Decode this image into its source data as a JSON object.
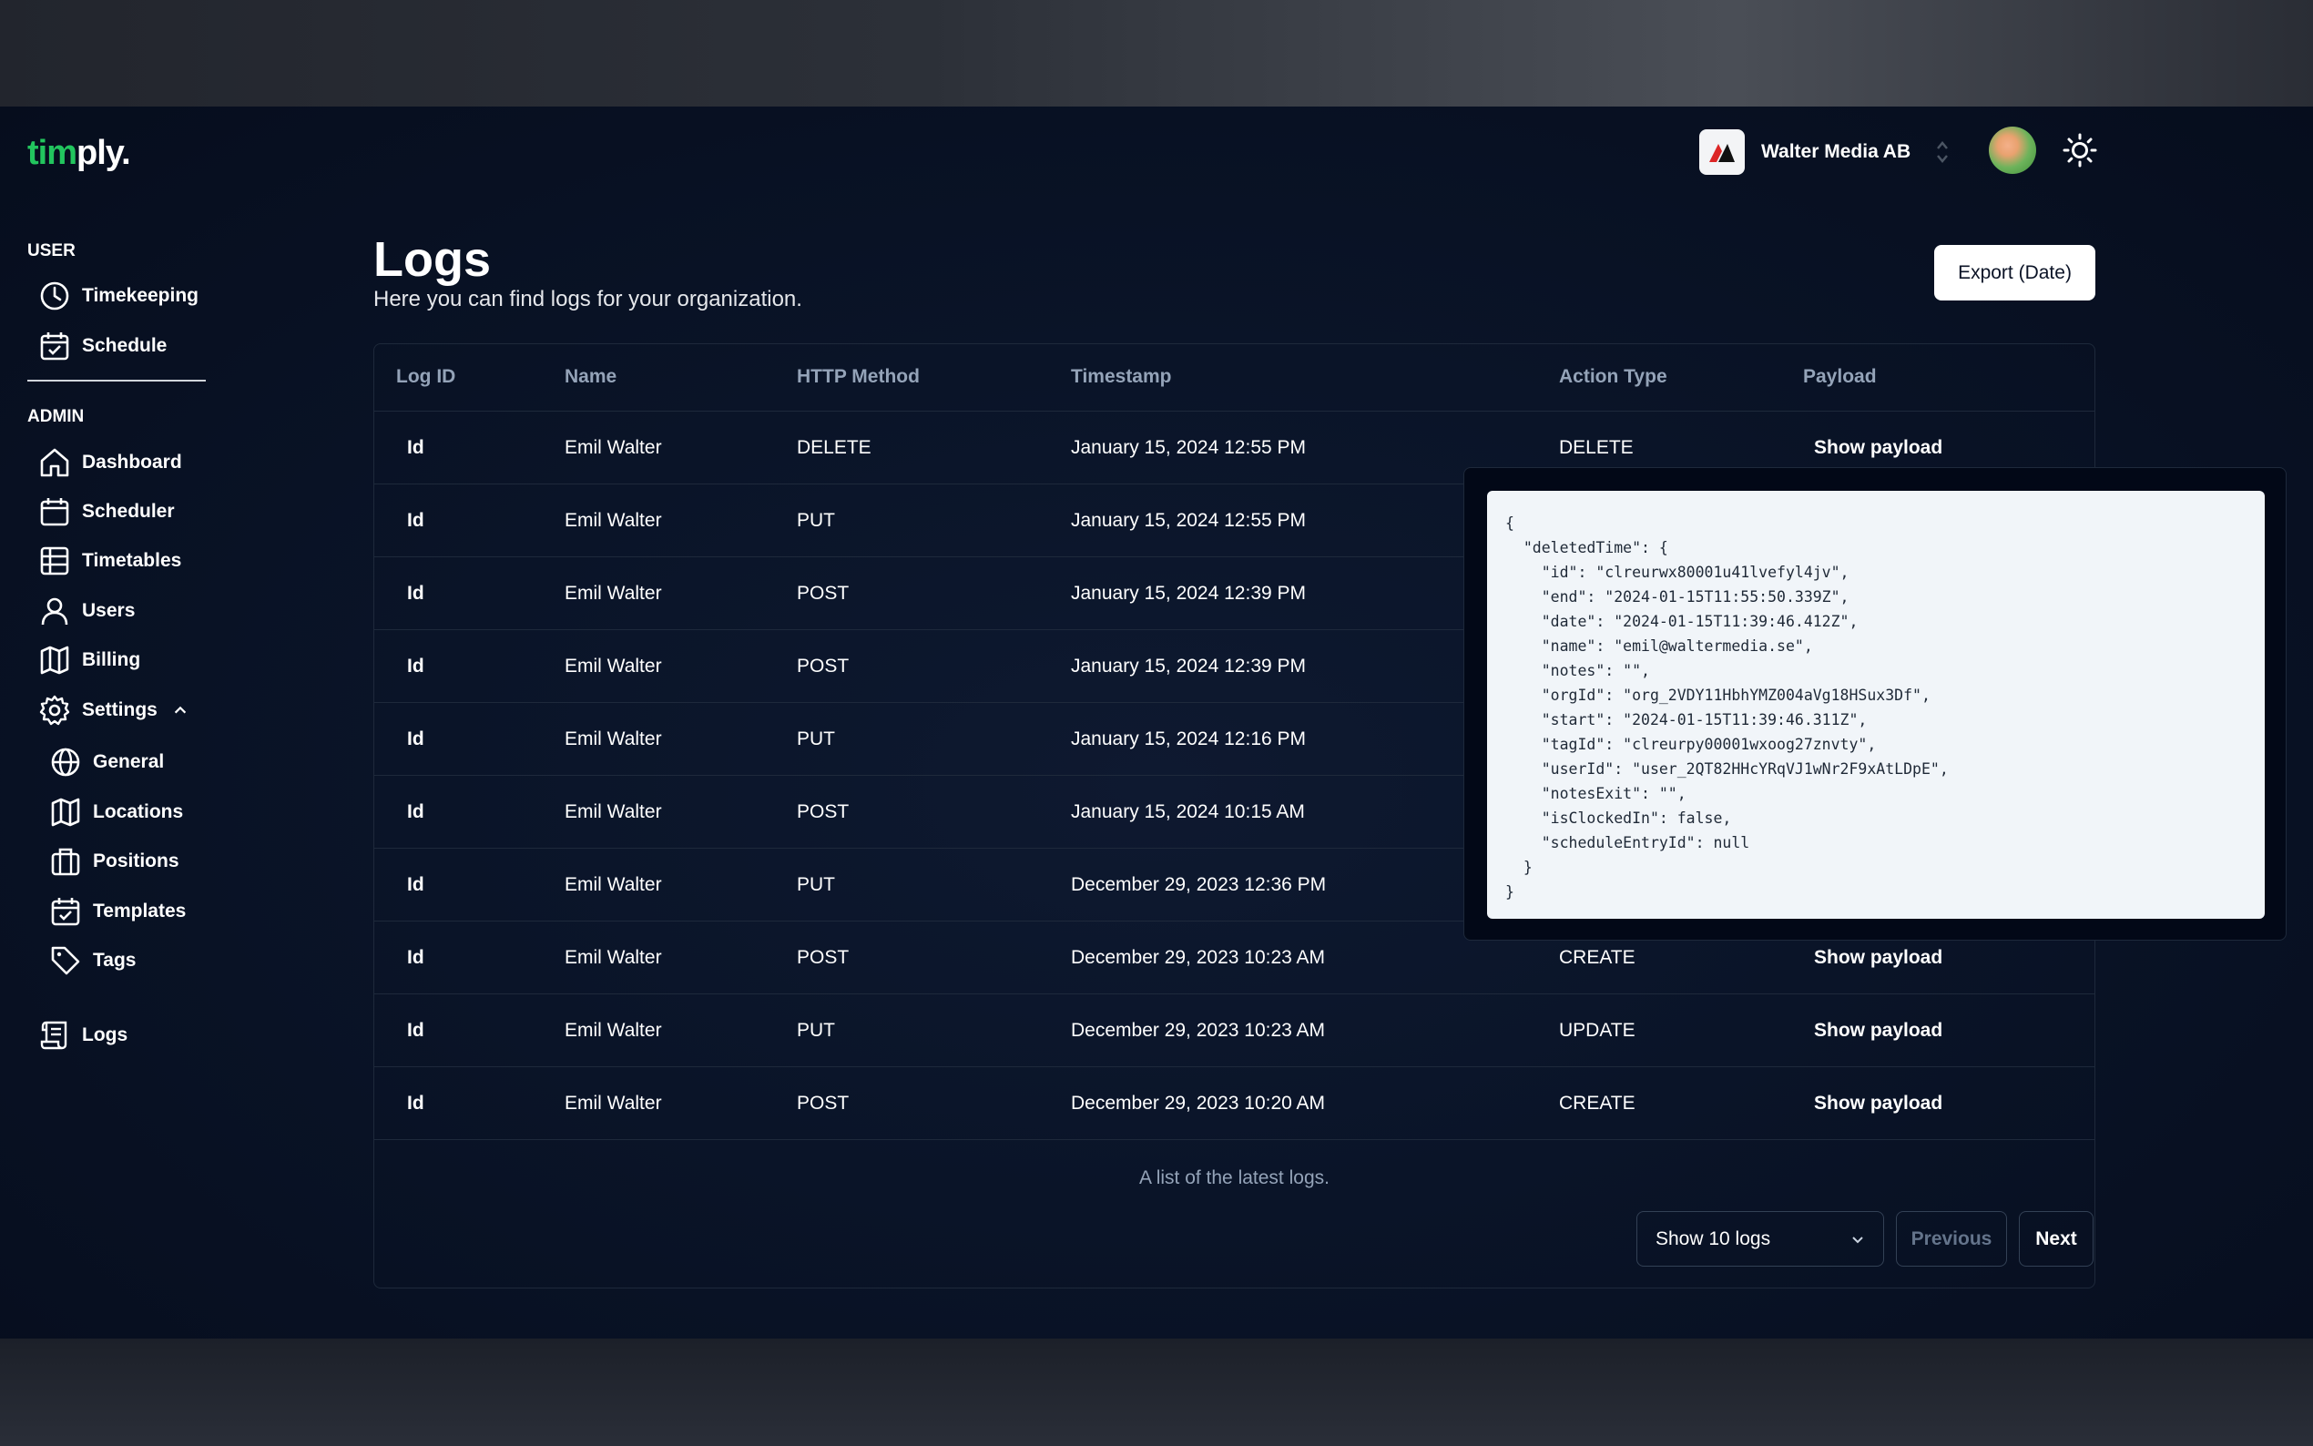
{
  "app": {
    "logo_accent": "tim",
    "logo_rest": "ply.",
    "org_name": "Walter Media AB",
    "accent_color": "#22c55e"
  },
  "sidebar": {
    "user_heading": "USER",
    "admin_heading": "ADMIN",
    "user_items": [
      {
        "label": "Timekeeping",
        "icon": "clock-icon"
      },
      {
        "label": "Schedule",
        "icon": "calendar-check-icon"
      }
    ],
    "admin_items": [
      {
        "label": "Dashboard",
        "icon": "home-icon"
      },
      {
        "label": "Scheduler",
        "icon": "calendar-icon"
      },
      {
        "label": "Timetables",
        "icon": "table-icon"
      },
      {
        "label": "Users",
        "icon": "user-icon"
      },
      {
        "label": "Billing",
        "icon": "map-icon"
      },
      {
        "label": "Settings",
        "icon": "gear-icon"
      }
    ],
    "settings_items": [
      {
        "label": "General",
        "icon": "globe-icon"
      },
      {
        "label": "Locations",
        "icon": "map-icon"
      },
      {
        "label": "Positions",
        "icon": "briefcase-icon"
      },
      {
        "label": "Templates",
        "icon": "calendar-check-icon"
      },
      {
        "label": "Tags",
        "icon": "tag-icon"
      }
    ],
    "logs_item": {
      "label": "Logs",
      "icon": "scroll-icon"
    }
  },
  "page": {
    "title": "Logs",
    "subtitle": "Here you can find logs for your organization.",
    "export_label": "Export (Date)"
  },
  "table": {
    "headers": [
      "Log ID",
      "Name",
      "HTTP Method",
      "Timestamp",
      "Action Type",
      "Payload"
    ],
    "rows": [
      {
        "id": "Id",
        "name": "Emil Walter",
        "method": "DELETE",
        "timestamp": "January 15, 2024 12:55 PM",
        "action": "DELETE",
        "payload": "Show payload"
      },
      {
        "id": "Id",
        "name": "Emil Walter",
        "method": "PUT",
        "timestamp": "January 15, 2024 12:55 PM",
        "action": "",
        "payload": ""
      },
      {
        "id": "Id",
        "name": "Emil Walter",
        "method": "POST",
        "timestamp": "January 15, 2024 12:39 PM",
        "action": "",
        "payload": ""
      },
      {
        "id": "Id",
        "name": "Emil Walter",
        "method": "POST",
        "timestamp": "January 15, 2024 12:39 PM",
        "action": "",
        "payload": ""
      },
      {
        "id": "Id",
        "name": "Emil Walter",
        "method": "PUT",
        "timestamp": "January 15, 2024 12:16 PM",
        "action": "",
        "payload": ""
      },
      {
        "id": "Id",
        "name": "Emil Walter",
        "method": "POST",
        "timestamp": "January 15, 2024 10:15 AM",
        "action": "",
        "payload": ""
      },
      {
        "id": "Id",
        "name": "Emil Walter",
        "method": "PUT",
        "timestamp": "December 29, 2023 12:36 PM",
        "action": "",
        "payload": ""
      },
      {
        "id": "Id",
        "name": "Emil Walter",
        "method": "POST",
        "timestamp": "December 29, 2023 10:23 AM",
        "action": "CREATE",
        "payload": "Show payload"
      },
      {
        "id": "Id",
        "name": "Emil Walter",
        "method": "PUT",
        "timestamp": "December 29, 2023 10:23 AM",
        "action": "UPDATE",
        "payload": "Show payload"
      },
      {
        "id": "Id",
        "name": "Emil Walter",
        "method": "POST",
        "timestamp": "December 29, 2023 10:20 AM",
        "action": "CREATE",
        "payload": "Show payload"
      }
    ],
    "caption": "A list of the latest logs."
  },
  "pagination": {
    "page_size_label": "Show 10 logs",
    "previous_label": "Previous",
    "next_label": "Next"
  },
  "payload_popover": {
    "json_text": "{\n  \"deletedTime\": {\n    \"id\": \"clreurwx80001u41lvefyl4jv\",\n    \"end\": \"2024-01-15T11:55:50.339Z\",\n    \"date\": \"2024-01-15T11:39:46.412Z\",\n    \"name\": \"emil@waltermedia.se\",\n    \"notes\": \"\",\n    \"orgId\": \"org_2VDY11HbhYMZ004aVg18HSux3Df\",\n    \"start\": \"2024-01-15T11:39:46.311Z\",\n    \"tagId\": \"clreurpy00001wxoog27znvty\",\n    \"userId\": \"user_2QT82HHcYRqVJ1wNr2F9xAtLDpE\",\n    \"notesExit\": \"\",\n    \"isClockedIn\": false,\n    \"scheduleEntryId\": null\n  }\n}"
  }
}
